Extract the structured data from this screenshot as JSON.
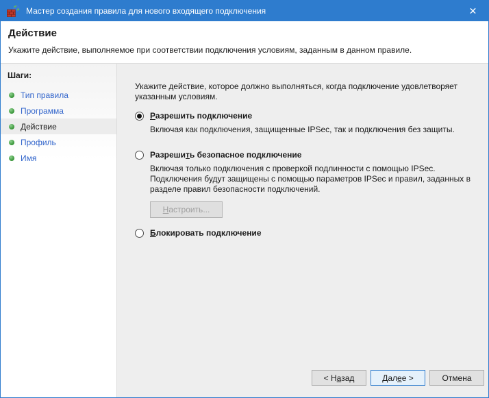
{
  "window": {
    "title": "Мастер создания правила для нового входящего подключения",
    "close_glyph": "✕",
    "titlebar_color": "#2e7cce",
    "app_icon": "firewall-icon"
  },
  "header": {
    "title": "Действие",
    "description": "Укажите действие, выполняемое при соответствии подключения условиям, заданным в данном правиле."
  },
  "sidebar": {
    "heading": "Шаги:",
    "link_color": "#3366cc",
    "bullet_color": "#2f8f2f",
    "steps": [
      {
        "label": "Тип правила",
        "current": false
      },
      {
        "label": "Программа",
        "current": false
      },
      {
        "label": "Действие",
        "current": true
      },
      {
        "label": "Профиль",
        "current": false
      },
      {
        "label": "Имя",
        "current": false
      }
    ]
  },
  "main": {
    "intro": "Укажите действие, которое должно выполняться, когда подключение удовлетворяет указанным условиям.",
    "options": [
      {
        "label_pre": "",
        "label_accel": "Р",
        "label_post": "азрешить подключение",
        "selected": true,
        "description": "Включая как подключения, защищенные IPSec, так и подключения без защиты."
      },
      {
        "label_pre": "Разреши",
        "label_accel": "т",
        "label_post": "ь безопасное подключение",
        "selected": false,
        "description": "Включая только подключения с проверкой подлинности с помощью IPSec. Подключения будут защищены с помощью параметров IPSec и правил, заданных в разделе правил безопасности подключений."
      },
      {
        "label_pre": "",
        "label_accel": "Б",
        "label_post": "локировать подключение",
        "selected": false,
        "description": ""
      }
    ],
    "configure_button": {
      "pre": "",
      "accel": "Н",
      "post": "астроить...",
      "disabled": true
    }
  },
  "footer": {
    "back": {
      "pre": "< Н",
      "accel": "а",
      "post": "зад"
    },
    "next": {
      "pre": "Дал",
      "accel": "е",
      "post": "е >"
    },
    "cancel": "Отмена"
  }
}
